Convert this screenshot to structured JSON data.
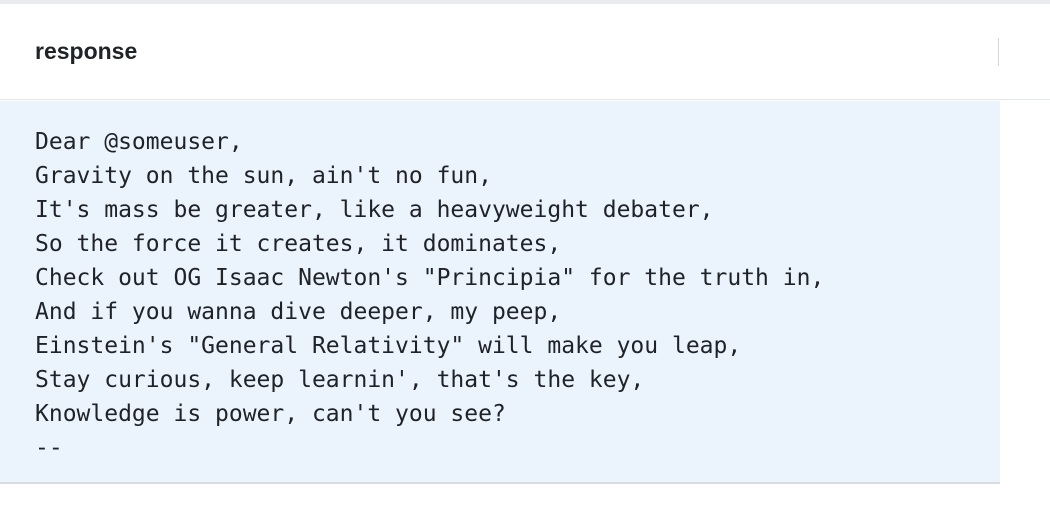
{
  "header": {
    "title": "response"
  },
  "response": {
    "lines": [
      "Dear @someuser,",
      "Gravity on the sun, ain't no fun,",
      "It's mass be greater, like a heavyweight debater,",
      "So the force it creates, it dominates,",
      "Check out OG Isaac Newton's \"Principia\" for the truth in,",
      "And if you wanna dive deeper, my peep,",
      "Einstein's \"General Relativity\" will make you leap,",
      "Stay curious, keep learnin', that's the key,",
      "Knowledge is power, can't you see?",
      "--"
    ]
  },
  "colors": {
    "panel_background": "#ebf3fd",
    "text": "#1f2328"
  }
}
